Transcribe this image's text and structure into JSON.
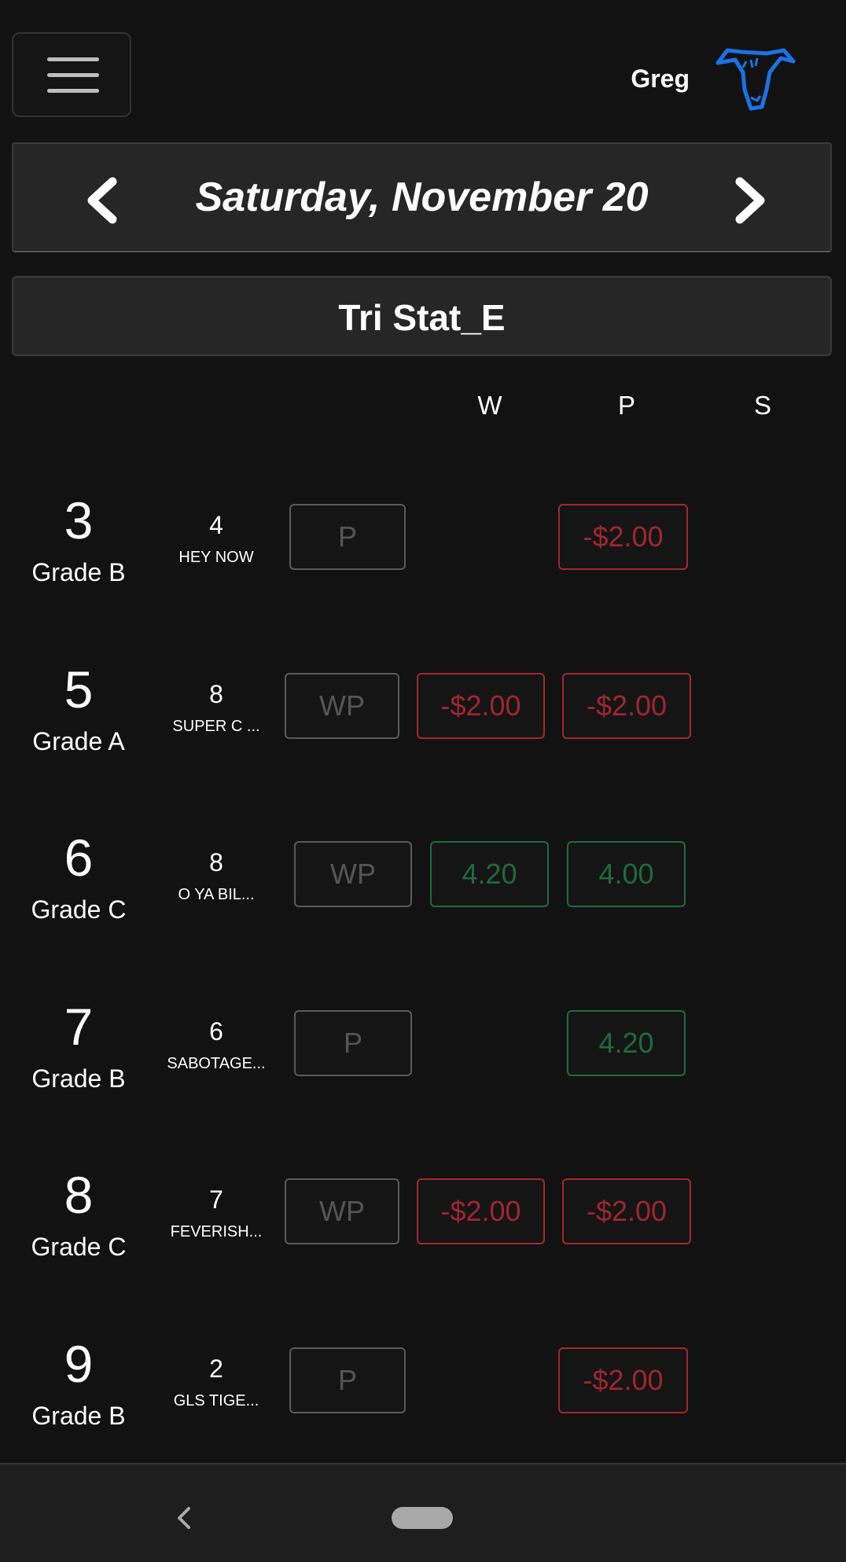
{
  "header": {
    "user_name": "Greg"
  },
  "date_bar": {
    "date": "Saturday, November 20"
  },
  "track": {
    "name": "Tri Stat_E"
  },
  "columns": [
    "W",
    "P",
    "S"
  ],
  "races": [
    {
      "race": "3",
      "grade": "Grade B",
      "dog_number": "4",
      "dog_name": "HEY NOW",
      "bet": "P",
      "w": "",
      "p": "-$2.00"
    },
    {
      "race": "5",
      "grade": "Grade A",
      "dog_number": "8",
      "dog_name": "SUPER C ...",
      "bet": "WP",
      "w": "-$2.00",
      "p": "-$2.00"
    },
    {
      "race": "6",
      "grade": "Grade C",
      "dog_number": "8",
      "dog_name": "O YA BIL...",
      "bet": "WP",
      "w": "4.20",
      "p": "4.00"
    },
    {
      "race": "7",
      "grade": "Grade B",
      "dog_number": "6",
      "dog_name": "SABOTAGE...",
      "bet": "P",
      "w": "",
      "p": "4.20"
    },
    {
      "race": "8",
      "grade": "Grade C",
      "dog_number": "7",
      "dog_name": "FEVERISH...",
      "bet": "WP",
      "w": "-$2.00",
      "p": "-$2.00"
    },
    {
      "race": "9",
      "grade": "Grade B",
      "dog_number": "2",
      "dog_name": "GLS TIGE...",
      "bet": "P",
      "w": "",
      "p": "-$2.00"
    }
  ],
  "colors": {
    "loss": "#a8252f",
    "win": "#1f6b3f",
    "avatar": "#1a73e8"
  },
  "icons": {
    "menu": "hamburger-icon",
    "avatar": "greyhound-icon",
    "prev": "chevron-left-icon",
    "next": "chevron-right-icon",
    "back": "back-icon"
  }
}
